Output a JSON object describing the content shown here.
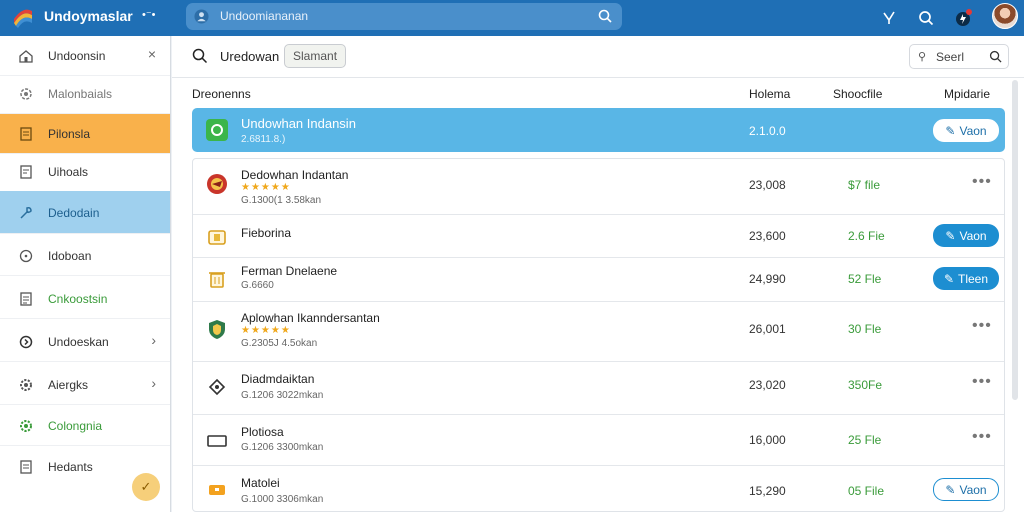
{
  "app": {
    "title": "Undoymaslar",
    "search_value": "Undoomiananan",
    "colors": {
      "topbar": "#1f6fb5",
      "accent": "#1d8ed1",
      "selected_row": "#59b6e6",
      "orange_item": "#f9b14b",
      "blue_item": "#9fd0ee",
      "size_green": "#3a9b3a",
      "star": "#f0a81c"
    }
  },
  "top_icons": [
    "close-x-icon",
    "search-icon",
    "notification-icon",
    "user-avatar"
  ],
  "sidebar": {
    "items": [
      {
        "label": "Undoonsin",
        "icon": "house-icon",
        "right": "×"
      },
      {
        "label": "Malonbaials",
        "icon": "settings-icon",
        "right": ""
      },
      {
        "label": "Pilonsla",
        "icon": "document-icon",
        "right": ""
      },
      {
        "label": "Uihoals",
        "icon": "document-icon",
        "right": ""
      },
      {
        "label": "Dedodain",
        "icon": "tool-icon",
        "right": ""
      },
      {
        "label": "Idoboan",
        "icon": "clock-icon",
        "right": ""
      },
      {
        "label": "Cnkoostsin",
        "icon": "list-icon",
        "right": ""
      },
      {
        "label": "Undoeskan",
        "icon": "circle-arrow-icon",
        "right": "›"
      },
      {
        "label": "Aiergks",
        "icon": "gear-icon",
        "right": "›"
      },
      {
        "label": "Colongnia",
        "icon": "gear-icon",
        "right": ""
      },
      {
        "label": "Hedants",
        "icon": "clipboard-icon",
        "right": ""
      }
    ],
    "fab": "✓"
  },
  "toolbar": {
    "title": "Uredowan",
    "chip": "Slamant",
    "search_label": "Seerl"
  },
  "columns": {
    "name": "Dreonenns",
    "col2": "Holema",
    "col3": "Shoocfile",
    "col4": "Mpidarie"
  },
  "rows": [
    {
      "name": "Undowhan Indansin",
      "stars": "",
      "sub": "2.6811.8.)",
      "num": "2.1.0.0",
      "size": "",
      "action": "Vaon",
      "action_style": "white"
    },
    {
      "name": "Dedowhan Indantan",
      "stars": "★★★★★",
      "sub": "G.1300(1 3.58kan",
      "num": "23,008",
      "size": "$7 file",
      "action": "",
      "action_style": "more"
    },
    {
      "name": "Fieborina",
      "stars": "",
      "sub": "",
      "num": "23,600",
      "size": "2.6 Fie",
      "action": "Vaon",
      "action_style": "filled"
    },
    {
      "name": "Ferman Dnelaene",
      "stars": "",
      "sub": "G.6660",
      "num": "24,990",
      "size": "52 Fle",
      "action": "Tleen",
      "action_style": "filled"
    },
    {
      "name": "Aplowhan Ikanndersantan",
      "stars": "★★★★★",
      "sub": "G.2305J 4.5okan",
      "num": "26,001",
      "size": "30 Fle",
      "action": "",
      "action_style": "more"
    },
    {
      "name": "Diadmdaiktan",
      "stars": "",
      "sub": "G.1206 3022mkan",
      "num": "23,020",
      "size": "350Fe",
      "action": "",
      "action_style": "more"
    },
    {
      "name": "Plotiosa",
      "stars": "",
      "sub": "G.1206 3300mkan",
      "num": "16,000",
      "size": "25 Fle",
      "action": "",
      "action_style": "more"
    },
    {
      "name": "Matolei",
      "stars": "",
      "sub": "G.1000 3306mkan",
      "num": "15,290",
      "size": "05 File",
      "action": "Vaon",
      "action_style": "outline"
    }
  ]
}
